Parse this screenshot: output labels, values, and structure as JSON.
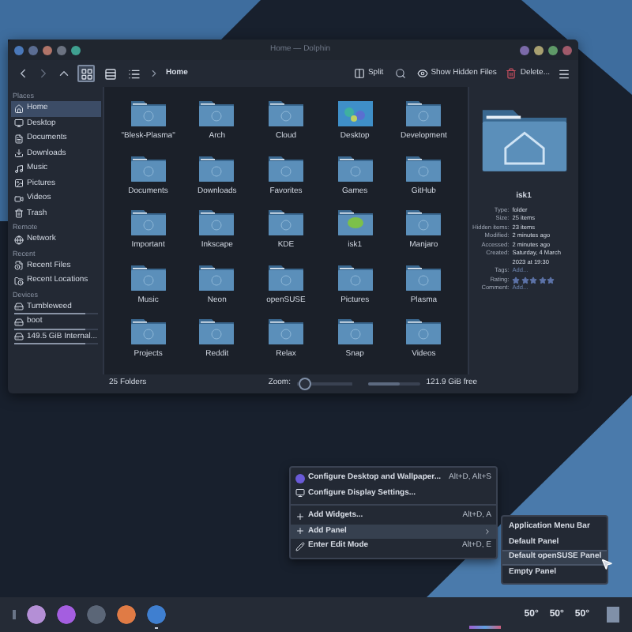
{
  "window": {
    "title": "Home — Dolphin",
    "breadcrumb": "Home",
    "view_modes": [
      {
        "kind": "icons",
        "selected": true
      },
      {
        "kind": "compact",
        "selected": false
      },
      {
        "kind": "details",
        "selected": false
      }
    ],
    "actions": [
      {
        "kind": "split",
        "label": "Split"
      },
      {
        "kind": "hidden",
        "label": "Show Hidden Files"
      },
      {
        "kind": "delete",
        "label": "Delete..."
      }
    ]
  },
  "sidebar": [
    {
      "heading": "Places",
      "items": [
        {
          "kind": "home",
          "label": "Home",
          "selected": true
        },
        {
          "kind": "desktop",
          "label": "Desktop",
          "selected": false
        },
        {
          "kind": "documents",
          "label": "Documents",
          "selected": false
        },
        {
          "kind": "downloads",
          "label": "Downloads",
          "selected": false
        },
        {
          "kind": "music",
          "label": "Music",
          "selected": false
        },
        {
          "kind": "pictures",
          "label": "Pictures",
          "selected": false
        },
        {
          "kind": "videos",
          "label": "Videos",
          "selected": false
        },
        {
          "kind": "trash",
          "label": "Trash",
          "selected": false
        }
      ]
    },
    {
      "heading": "Remote",
      "items": [
        {
          "kind": "network",
          "label": "Network",
          "selected": false
        }
      ]
    },
    {
      "heading": "Recent",
      "items": [
        {
          "kind": "recent-files",
          "label": "Recent Files",
          "selected": false
        },
        {
          "kind": "recent-locations",
          "label": "Recent Locations",
          "selected": false
        }
      ]
    },
    {
      "heading": "Devices",
      "items": [
        {
          "kind": "drive",
          "label": "Tumbleweed",
          "selected": false,
          "level": 0.85
        },
        {
          "kind": "drive",
          "label": "boot",
          "selected": false,
          "level": 0.85
        },
        {
          "kind": "drive",
          "label": "149.5 GiB Internal...",
          "selected": false,
          "level": 0.85
        }
      ]
    }
  ],
  "files": [
    {
      "name": "\"Blesk-Plasma\"",
      "kind": "folder"
    },
    {
      "name": "Arch",
      "kind": "folder"
    },
    {
      "name": "Cloud",
      "kind": "folder"
    },
    {
      "name": "Desktop",
      "kind": "image"
    },
    {
      "name": "Development",
      "kind": "folder"
    },
    {
      "name": "Documents",
      "kind": "folder"
    },
    {
      "name": "Downloads",
      "kind": "folder"
    },
    {
      "name": "Favorites",
      "kind": "folder"
    },
    {
      "name": "Games",
      "kind": "folder"
    },
    {
      "name": "GitHub",
      "kind": "folder"
    },
    {
      "name": "Important",
      "kind": "folder"
    },
    {
      "name": "Inkscape",
      "kind": "folder"
    },
    {
      "name": "KDE",
      "kind": "folder"
    },
    {
      "name": "isk1",
      "kind": "custom"
    },
    {
      "name": "Manjaro",
      "kind": "folder"
    },
    {
      "name": "Music",
      "kind": "folder"
    },
    {
      "name": "Neon",
      "kind": "folder"
    },
    {
      "name": "openSUSE",
      "kind": "folder"
    },
    {
      "name": "Pictures",
      "kind": "folder"
    },
    {
      "name": "Plasma",
      "kind": "folder"
    },
    {
      "name": "Projects",
      "kind": "folder"
    },
    {
      "name": "Reddit",
      "kind": "folder"
    },
    {
      "name": "Relax",
      "kind": "folder"
    },
    {
      "name": "Snap",
      "kind": "folder"
    },
    {
      "name": "Videos",
      "kind": "folder"
    }
  ],
  "info_panel": {
    "name": "isk1",
    "fields": [
      {
        "label": "Type:",
        "value": "folder",
        "kind": "text"
      },
      {
        "label": "Size:",
        "value": "25 items",
        "kind": "text"
      },
      {
        "label": "Hidden items:",
        "value": "23 items",
        "kind": "text"
      },
      {
        "label": "Modified:",
        "value": "2 minutes ago",
        "kind": "text"
      },
      {
        "label": "Accessed:",
        "value": "2 minutes ago",
        "kind": "text"
      },
      {
        "label": "Created:",
        "value": "Saturday, 4 March 2023 at 19:30",
        "kind": "text"
      },
      {
        "label": "Tags:",
        "value": "Add...",
        "kind": "link"
      },
      {
        "label": "Rating:",
        "stars": 5,
        "kind": "rating"
      },
      {
        "label": "Comment:",
        "value": "Add...",
        "kind": "link"
      }
    ]
  },
  "status_bar": {
    "count": "25 Folders",
    "zoom_label": "Zoom:",
    "zoom": {
      "level": 0.05
    },
    "space": {
      "level": 0.6
    },
    "free": "121.9 GiB free"
  },
  "context_menu": [
    {
      "kind": "wallpaper",
      "label": "Configure Desktop and Wallpaper...",
      "shortcut": "Alt+D, Alt+S",
      "highlighted": false,
      "submenu": false
    },
    {
      "kind": "display",
      "label": "Configure Display Settings...",
      "highlighted": false,
      "submenu": false
    },
    {
      "kind": "separator"
    },
    {
      "kind": "add",
      "label": "Add Widgets...",
      "shortcut": "Alt+D, A",
      "highlighted": false,
      "submenu": false
    },
    {
      "kind": "add",
      "label": "Add Panel",
      "highlighted": true,
      "submenu": true
    },
    {
      "kind": "edit",
      "label": "Enter Edit Mode",
      "shortcut": "Alt+D, E",
      "highlighted": false,
      "submenu": false
    }
  ],
  "submenu": [
    {
      "label": "Application Menu Bar",
      "highlighted": false
    },
    {
      "label": "Default Panel",
      "highlighted": false
    },
    {
      "label": "Default openSUSE Panel",
      "highlighted": true
    },
    {
      "label": "Empty Panel",
      "highlighted": false
    }
  ],
  "taskbar": {
    "apps": [
      {
        "color": "#b48fd6",
        "active": false
      },
      {
        "color": "#a45ee0",
        "active": false
      },
      {
        "color": "#5b6677",
        "active": false
      },
      {
        "color": "#e07b45",
        "active": false
      },
      {
        "color": "#3f7fd0",
        "active": true
      }
    ],
    "temperatures": [
      "50°",
      "50°",
      "50°"
    ]
  }
}
